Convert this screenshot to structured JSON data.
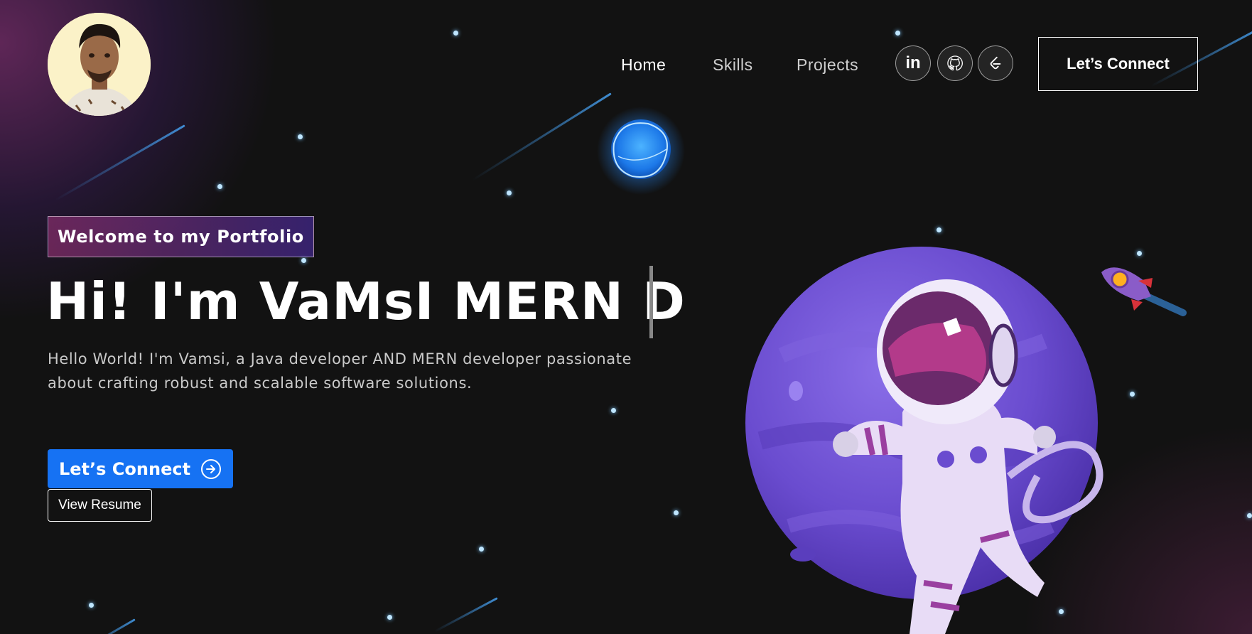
{
  "nav": {
    "links": [
      "Home",
      "Skills",
      "Projects"
    ],
    "socials": [
      "linkedin-icon",
      "github-icon",
      "leetcode-icon"
    ],
    "connect_label": "Let’s Connect"
  },
  "hero": {
    "tagline": "Welcome to my Portfolio",
    "headline": "Hi! I'm VaMsI MERN D",
    "description": "Hello World! I'm Vamsi, a Java developer AND MERN developer passionate about crafting robust and scalable software solutions.",
    "connect_label": "Let’s Connect",
    "resume_label": "View Resume"
  },
  "colors": {
    "background": "#121212",
    "accent_blue": "#1672f3",
    "planet_purple": "#6a4ccf"
  }
}
